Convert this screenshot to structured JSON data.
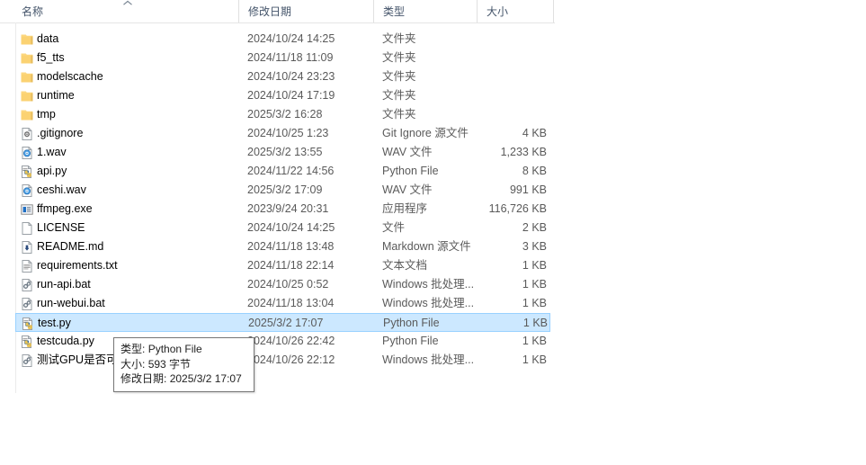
{
  "columns": {
    "name": "名称",
    "date_modified": "修改日期",
    "type": "类型",
    "size": "大小",
    "sort_indicator": "ascending-chevron"
  },
  "files": [
    {
      "icon": "folder-icon",
      "name": "data",
      "date": "2024/10/24 14:25",
      "type": "文件夹",
      "size": ""
    },
    {
      "icon": "folder-icon",
      "name": "f5_tts",
      "date": "2024/11/18 11:09",
      "type": "文件夹",
      "size": ""
    },
    {
      "icon": "folder-icon",
      "name": "modelscache",
      "date": "2024/10/24 23:23",
      "type": "文件夹",
      "size": ""
    },
    {
      "icon": "folder-icon",
      "name": "runtime",
      "date": "2024/10/24 17:19",
      "type": "文件夹",
      "size": ""
    },
    {
      "icon": "folder-icon",
      "name": "tmp",
      "date": "2025/3/2 16:28",
      "type": "文件夹",
      "size": ""
    },
    {
      "icon": "gitignore-icon",
      "name": ".gitignore",
      "date": "2024/10/25 1:23",
      "type": "Git Ignore 源文件",
      "size": "4 KB"
    },
    {
      "icon": "wav-audio-icon",
      "name": "1.wav",
      "date": "2025/3/2 13:55",
      "type": "WAV 文件",
      "size": "1,233 KB"
    },
    {
      "icon": "python-file-icon",
      "name": "api.py",
      "date": "2024/11/22 14:56",
      "type": "Python File",
      "size": "8 KB"
    },
    {
      "icon": "wav-audio-icon",
      "name": "ceshi.wav",
      "date": "2025/3/2 17:09",
      "type": "WAV 文件",
      "size": "991 KB"
    },
    {
      "icon": "application-icon",
      "name": "ffmpeg.exe",
      "date": "2023/9/24 20:31",
      "type": "应用程序",
      "size": "116,726 KB"
    },
    {
      "icon": "blank-file-icon",
      "name": "LICENSE",
      "date": "2024/10/24 14:25",
      "type": "文件",
      "size": "2 KB"
    },
    {
      "icon": "markdown-file-icon",
      "name": "README.md",
      "date": "2024/11/18 13:48",
      "type": "Markdown 源文件",
      "size": "3 KB"
    },
    {
      "icon": "text-file-icon",
      "name": "requirements.txt",
      "date": "2024/11/18 22:14",
      "type": "文本文档",
      "size": "1 KB"
    },
    {
      "icon": "batch-file-icon",
      "name": "run-api.bat",
      "date": "2024/10/25 0:52",
      "type": "Windows 批处理...",
      "size": "1 KB"
    },
    {
      "icon": "batch-file-icon",
      "name": "run-webui.bat",
      "date": "2024/11/18 13:04",
      "type": "Windows 批处理...",
      "size": "1 KB"
    },
    {
      "icon": "python-file-icon",
      "name": "test.py",
      "date": "2025/3/2 17:07",
      "type": "Python File",
      "size": "1 KB",
      "selected": true
    },
    {
      "icon": "python-file-icon",
      "name": "testcuda.py",
      "date": "2024/10/26 22:42",
      "type": "Python File",
      "size": "1 KB"
    },
    {
      "icon": "batch-file-icon",
      "name": "测试GPU是否可用",
      "date": "2024/10/26 22:12",
      "type": "Windows 批处理...",
      "size": "1 KB"
    }
  ],
  "tooltip": {
    "lines": [
      {
        "key": "类型:",
        "value": "Python File"
      },
      {
        "key": "大小:",
        "value": "593 字节"
      },
      {
        "key": "修改日期:",
        "value": "2025/3/2 17:07"
      }
    ]
  },
  "colors": {
    "selection_fill": "#cce8ff",
    "selection_border": "#99d1ff",
    "header_text": "#44546a",
    "secondary_text": "#5a5a5a",
    "folder_yellow": "#fcd77f"
  }
}
